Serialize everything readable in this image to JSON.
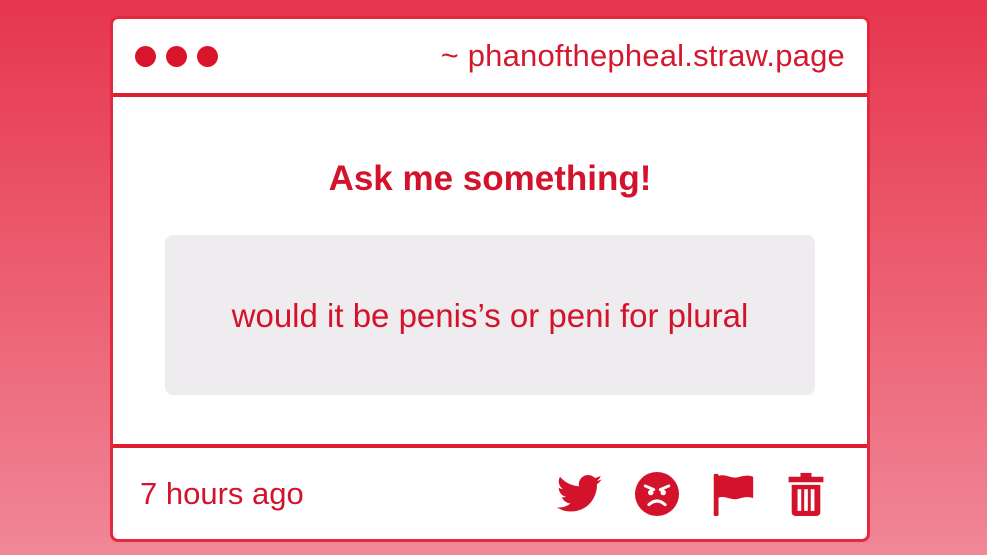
{
  "window": {
    "url": "~ phanofthepheal.straw.page"
  },
  "content": {
    "heading": "Ask me something!",
    "question": "would it be penis’s or peni for plural"
  },
  "footer": {
    "timestamp": "7 hours ago",
    "icons": [
      "twitter-icon",
      "angry-face-icon",
      "flag-icon",
      "trash-icon"
    ]
  },
  "colors": {
    "accent": "#d3132b",
    "border": "#dc1f33",
    "question_bg": "#eeecee",
    "background_top": "#e6364f",
    "background_bottom": "#f08797"
  }
}
